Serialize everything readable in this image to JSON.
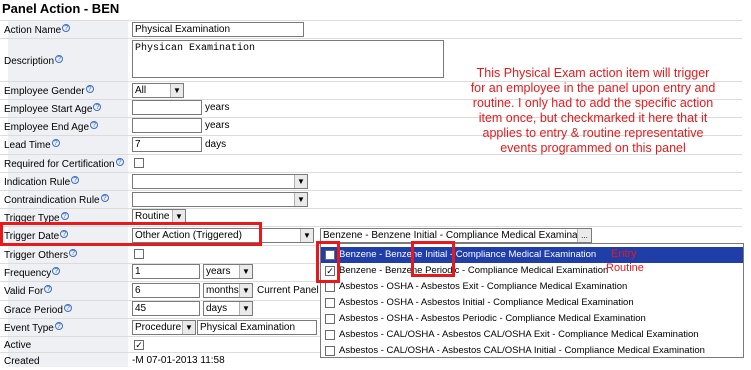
{
  "panel": {
    "title": "Panel Action - BEN"
  },
  "labels": {
    "action_name": "Action Name",
    "description": "Description",
    "employee_gender": "Employee Gender",
    "employee_start_age": "Employee Start Age",
    "employee_end_age": "Employee End Age",
    "lead_time": "Lead Time",
    "required_for_certification": "Required for Certification",
    "indication_rule": "Indication Rule",
    "contraindication_rule": "Contraindication Rule",
    "trigger_type": "Trigger Type",
    "trigger_date": "Trigger Date",
    "trigger_others": "Trigger Others",
    "frequency": "Frequency",
    "valid_for": "Valid For",
    "grace_period": "Grace Period",
    "event_type": "Event Type",
    "active": "Active",
    "created": "Created"
  },
  "fields": {
    "action_name": "Physical Examination",
    "description": "Physican Examination",
    "employee_gender": "All",
    "start_age_unit": "years",
    "end_age_unit": "years",
    "lead_time": "7",
    "lead_time_unit": "days",
    "trigger_type": "Routine",
    "trigger_date": "Other Action (Triggered)",
    "trigger_action": "Benzene - Benzene Initial - Compliance Medical Examination...",
    "trigger_action_button": "...",
    "frequency": "1",
    "frequency_unit": "years",
    "valid_for": "6",
    "valid_for_unit": "months",
    "valid_for_suffix": "Current Panel",
    "grace_period": "45",
    "grace_period_unit": "days",
    "event_type": "Procedure",
    "event_name": "Physical Examination",
    "created": "-M 07-01-2013 11:58"
  },
  "dropdown_items": [
    {
      "label": "Benzene - Benzene Initial - Compliance Medical Examination",
      "checked": true
    },
    {
      "label": "Benzene - Benzene Periodic - Compliance Medical Examination",
      "checked": true
    },
    {
      "label": "Asbestos - OSHA - Asbestos Exit - Compliance Medical Examination",
      "checked": false
    },
    {
      "label": "Asbestos - OSHA - Asbestos Initial - Compliance Medical Examination",
      "checked": false
    },
    {
      "label": "Asbestos - OSHA - Asbestos Periodic - Compliance Medical Examination",
      "checked": false
    },
    {
      "label": "Asbestos - CAL/OSHA - Asbestos CAL/OSHA Exit - Compliance Medical Examination",
      "checked": false
    },
    {
      "label": "Asbestos - CAL/OSHA - Asbestos CAL/OSHA Initial - Compliance Medical Examination",
      "checked": false
    }
  ],
  "annotations": {
    "note": "This Physical Exam action item will trigger for an employee in the panel upon entry and routine.  I only had to add the specific action item once, but checkmarked it here that it applies to entry & routine representative events programmed on this panel",
    "entry": "Entry",
    "routine": "Routine"
  },
  "colors": {
    "annotation": "#e8191c",
    "selection": "#1f3ea8"
  }
}
